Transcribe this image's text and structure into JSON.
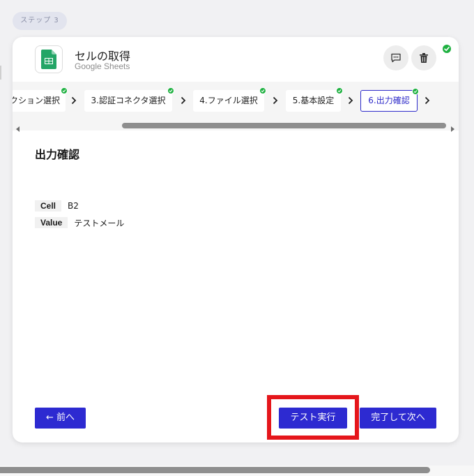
{
  "step_badge": "ステップ 3",
  "app": {
    "title": "セルの取得",
    "subtitle": "Google Sheets",
    "icon": "google-sheets-icon"
  },
  "header_actions": [
    {
      "name": "comment",
      "icon": "comment-icon"
    },
    {
      "name": "delete",
      "icon": "trash-icon"
    }
  ],
  "tabs": [
    {
      "label": "アクション選択",
      "completed": true,
      "active": false
    },
    {
      "label": "3.認証コネクタ選択",
      "completed": true,
      "active": false
    },
    {
      "label": "4.ファイル選択",
      "completed": true,
      "active": false
    },
    {
      "label": "5.基本設定",
      "completed": true,
      "active": false
    },
    {
      "label": "6.出力確認",
      "completed": true,
      "active": true
    }
  ],
  "section_title": "出力確認",
  "outputs": [
    {
      "key": "Cell",
      "value": "B2"
    },
    {
      "key": "Value",
      "value": "テストメール"
    }
  ],
  "buttons": {
    "back": "← 前へ",
    "test_run": "テスト実行",
    "complete_next": "完了して次へ"
  },
  "colors": {
    "primary": "#2d2ad1",
    "success": "#1fb141",
    "highlight": "#e5161b"
  }
}
